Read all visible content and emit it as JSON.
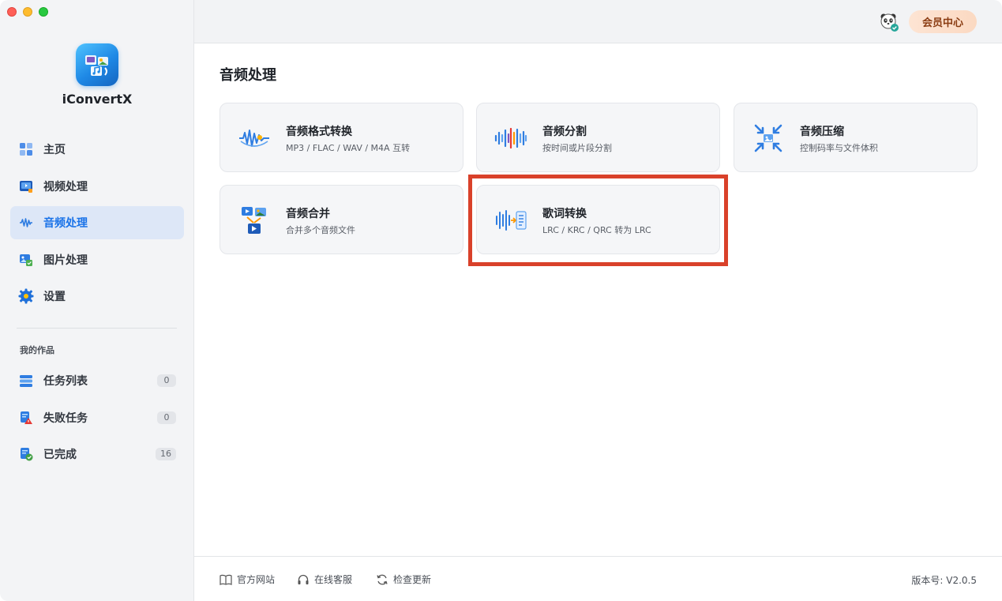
{
  "app": {
    "name": "iConvertX"
  },
  "colors": {
    "accent": "#1a73e8",
    "highlight": "#d9412a",
    "vip_bg": "#fbd9c2"
  },
  "nav": {
    "items": [
      {
        "label": "主页",
        "icon": "home-icon"
      },
      {
        "label": "视频处理",
        "icon": "video-icon"
      },
      {
        "label": "音频处理",
        "icon": "audio-wave-icon",
        "active": true
      },
      {
        "label": "图片处理",
        "icon": "image-icon"
      },
      {
        "label": "设置",
        "icon": "gear-icon"
      }
    ]
  },
  "works": {
    "title": "我的作品",
    "items": [
      {
        "label": "任务列表",
        "count": "0",
        "icon": "task-list-icon"
      },
      {
        "label": "失败任务",
        "count": "0",
        "icon": "failed-task-icon"
      },
      {
        "label": "已完成",
        "count": "16",
        "icon": "completed-icon"
      }
    ]
  },
  "header": {
    "vip_label": "会员中心",
    "avatar_icon": "panda-avatar-icon"
  },
  "main": {
    "title": "音频处理",
    "cards": [
      {
        "title": "音频格式转换",
        "sub": "MP3 / FLAC / WAV / M4A 互转",
        "icon": "audio-format-icon"
      },
      {
        "title": "音频分割",
        "sub": "按时间或片段分割",
        "icon": "audio-split-icon"
      },
      {
        "title": "音频压缩",
        "sub": "控制码率与文件体积",
        "icon": "audio-compress-icon"
      },
      {
        "title": "音频合并",
        "sub": "合并多个音频文件",
        "icon": "audio-merge-icon"
      },
      {
        "title": "歌词转换",
        "sub": "LRC / KRC / QRC 转为 LRC",
        "icon": "lyrics-convert-icon",
        "highlighted": true
      }
    ]
  },
  "footer": {
    "website": "官方网站",
    "support": "在线客服",
    "update": "检查更新",
    "version": "版本号:  V2.0.5"
  }
}
